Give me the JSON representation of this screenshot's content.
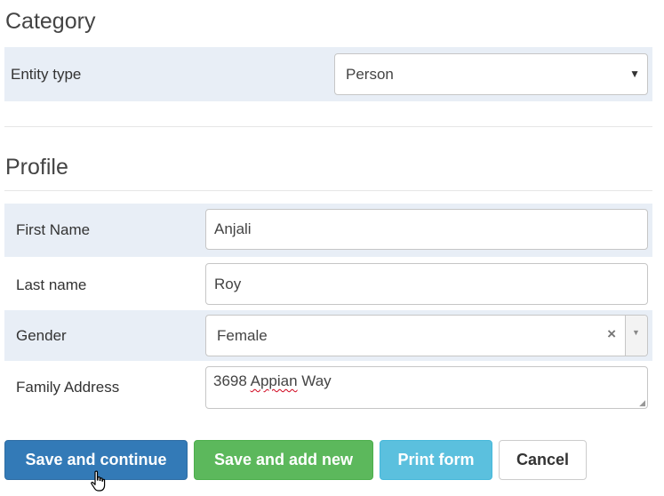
{
  "category": {
    "heading": "Category",
    "entity_type_label": "Entity type",
    "entity_type_value": "Person"
  },
  "profile": {
    "heading": "Profile",
    "first_name_label": "First Name",
    "first_name_value": "Anjali",
    "last_name_label": "Last name",
    "last_name_value": "Roy",
    "gender_label": "Gender",
    "gender_value": "Female",
    "address_label": "Family Address",
    "address_value_number": "3698",
    "address_value_street": "Appian",
    "address_value_suffix": "Way"
  },
  "buttons": {
    "save_continue": "Save and continue",
    "save_add_new": "Save and add new",
    "print_form": "Print form",
    "cancel": "Cancel"
  },
  "colors": {
    "row_shade": "#e8eef6",
    "primary": "#337ab7",
    "success": "#5cb85c",
    "info": "#5bc0de",
    "default_border": "#cccccc"
  },
  "icons": {
    "dropdown": "caret-down-icon",
    "clear": "clear-x-icon",
    "cursor": "hand-pointer-icon"
  }
}
